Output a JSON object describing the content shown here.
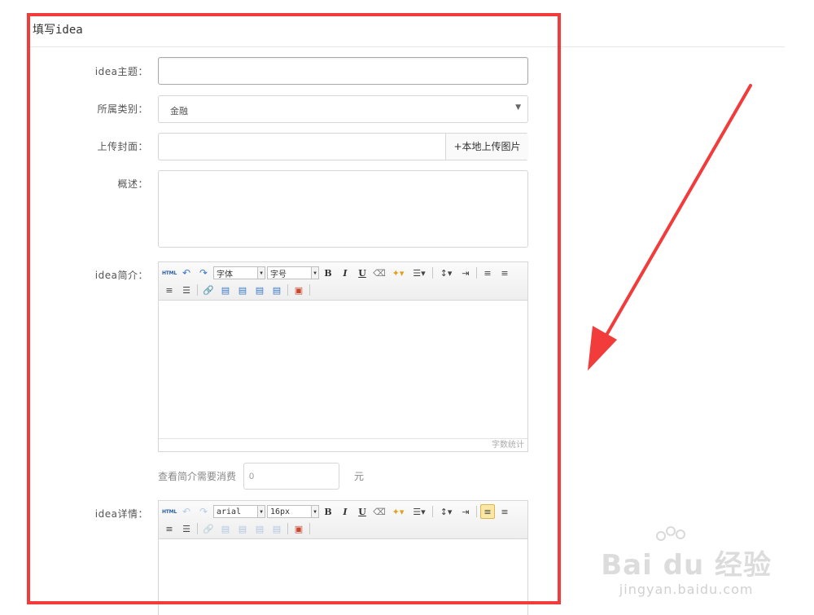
{
  "page": {
    "title": "填写idea"
  },
  "form": {
    "topic": {
      "label": "idea主题：",
      "value": ""
    },
    "category": {
      "label": "所属类别：",
      "value": "金融"
    },
    "cover": {
      "label": "上传封面：",
      "value": "",
      "button": "+本地上传图片"
    },
    "summary": {
      "label": "概述：",
      "value": ""
    },
    "intro": {
      "label": "idea简介：",
      "font_value": "字体",
      "size_value": "字号",
      "word_count": "字数统计"
    },
    "cost": {
      "label": "查看简介需要消费",
      "value": "0",
      "unit": "元"
    },
    "detail": {
      "label": "idea详情：",
      "font_value": "arial",
      "size_value": "16px"
    }
  },
  "toolbar": {
    "html": "HTML",
    "bold": "B",
    "italic": "I",
    "underline": "U"
  },
  "watermark": {
    "logo": "Bai du 经验",
    "url": "jingyan.baidu.com"
  },
  "colors": {
    "annotation_red": "#f23b3b",
    "border": "#d6d6d6"
  }
}
